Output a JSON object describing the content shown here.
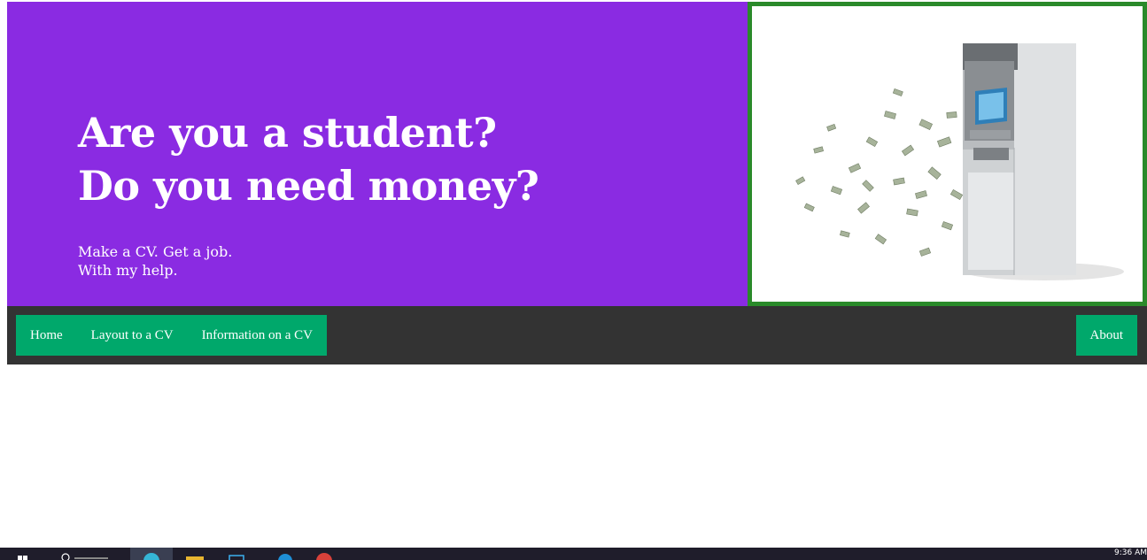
{
  "hero": {
    "title_line1": "Are you a student?",
    "title_line2": "Do you need money?",
    "sub_line1": "Make a CV. Get a job.",
    "sub_line2": "With my help.",
    "image_icon": "atm-money-image",
    "background_color": "#8a2be2",
    "image_border_color": "#2a8a2a"
  },
  "nav": {
    "items": [
      {
        "label": "Home"
      },
      {
        "label": "Layout to a CV"
      },
      {
        "label": "Information on a CV"
      }
    ],
    "about_label": "About",
    "bar_color": "#333333",
    "button_color": "#00a86b"
  },
  "taskbar": {
    "clock": "9:36 AM",
    "icons": [
      "windows-start-icon",
      "search-icon",
      "browser-icon",
      "file-explorer-icon",
      "store-icon",
      "edge-icon",
      "chrome-icon"
    ]
  }
}
